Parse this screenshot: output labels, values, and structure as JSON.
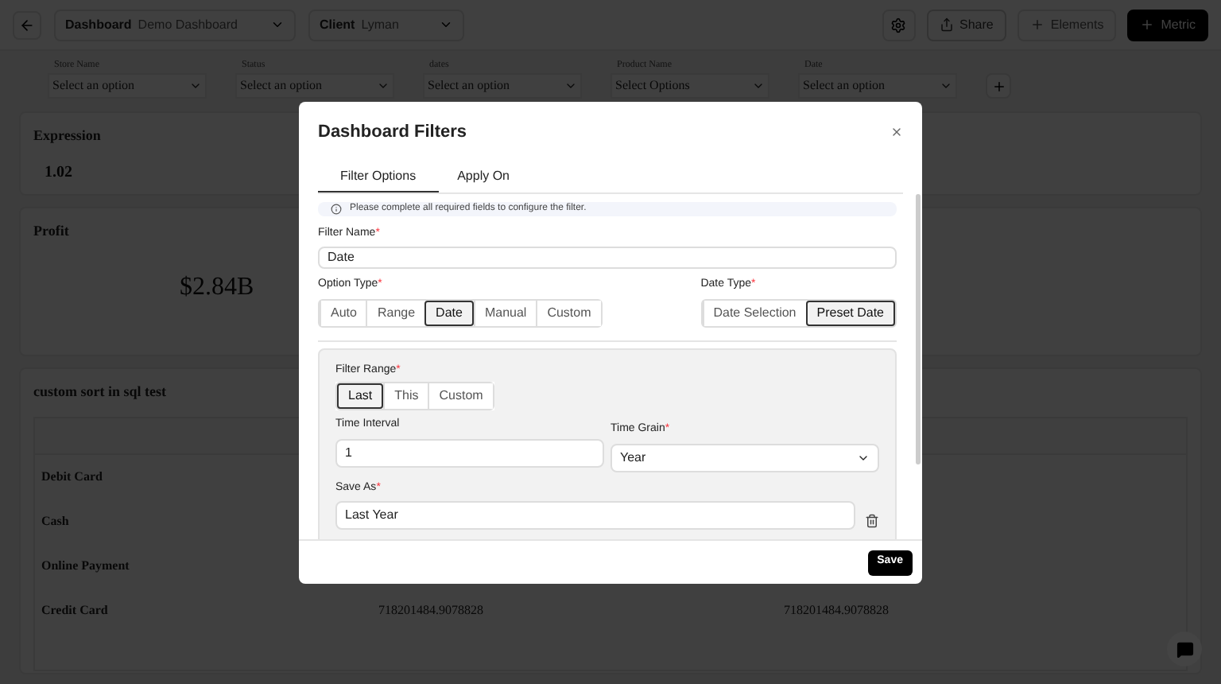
{
  "top_bar": {
    "dashboard": {
      "label": "Dashboard",
      "value": "Demo Dashboard"
    },
    "client": {
      "label": "Client",
      "value": "Lyman"
    },
    "buttons": [
      {
        "label": "Share",
        "kind": "outline"
      },
      {
        "label": "Elements",
        "kind": "ghost"
      },
      {
        "label": "Metric",
        "kind": "primary"
      }
    ]
  },
  "filters": [
    {
      "label": "Store Name",
      "placeholder": "Select an option"
    },
    {
      "label": "Status",
      "placeholder": "Select an option"
    },
    {
      "label": "dates",
      "placeholder": "Select an option"
    },
    {
      "label": "Product Name",
      "placeholder": "Select Options"
    },
    {
      "label": "Date",
      "placeholder": "Select an option"
    }
  ],
  "expression_card": {
    "title": "Expression",
    "value": "1.02"
  },
  "profit_card": {
    "title": "Profit",
    "value": "$2.84B"
  },
  "table_card": {
    "title": "custom sort in sql test",
    "rows": [
      {
        "cells": [
          "Debit Card"
        ]
      },
      {
        "cells": [
          "Cash"
        ]
      },
      {
        "cells": [
          "Online Payment"
        ]
      },
      {
        "cells": [
          "Credit Card",
          "718201484.9078828",
          "718201484.9078828"
        ]
      }
    ]
  },
  "modal": {
    "title": "Dashboard Filters",
    "tabs": [
      {
        "label": "Filter Options",
        "selected": true
      },
      {
        "label": "Apply On",
        "selected": false
      }
    ],
    "info": "Please complete all required fields to configure the filter.",
    "filter_name": {
      "label": "Filter Name",
      "required_mark": "*",
      "value": "Date"
    },
    "option_type": {
      "label": "Option Type",
      "required_mark": "*",
      "options": [
        {
          "label": "Auto",
          "selected": false
        },
        {
          "label": "Range",
          "selected": false
        },
        {
          "label": "Date",
          "selected": true
        },
        {
          "label": "Manual",
          "selected": false
        },
        {
          "label": "Custom",
          "selected": false
        }
      ]
    },
    "date_type": {
      "label": "Date Type",
      "required_mark": "*",
      "options": [
        {
          "label": "Date Selection",
          "selected": false
        },
        {
          "label": "Preset Date",
          "selected": true
        }
      ]
    },
    "filter_range": {
      "label": "Filter Range",
      "required_mark": "*",
      "options": [
        {
          "label": "Last",
          "selected": true
        },
        {
          "label": "This",
          "selected": false
        },
        {
          "label": "Custom",
          "selected": false
        }
      ]
    },
    "time_interval": {
      "label": "Time Interval",
      "value": "1"
    },
    "time_grain": {
      "label": "Time Grain",
      "required_mark": "*",
      "value": "Year"
    },
    "save_as": {
      "label": "Save As",
      "required_mark": "*",
      "value": "Last Year"
    },
    "save_button": "Save"
  }
}
